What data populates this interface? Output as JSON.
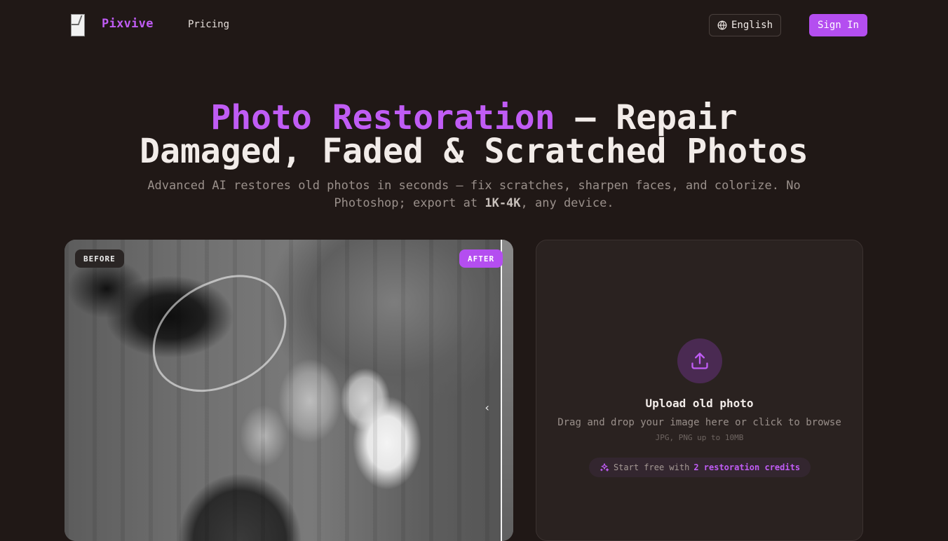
{
  "nav": {
    "brand": "Pixvive",
    "links": [
      "Pricing"
    ],
    "language": "English",
    "sign_in": "Sign In"
  },
  "hero": {
    "title_accent": "Photo Restoration",
    "title_rest": " — Repair",
    "title_line2": "Damaged, Faded & Scratched Photos",
    "subtitle_pre": "Advanced AI restores old photos in seconds — fix scratches, sharpen faces, and colorize. No Photoshop; export at ",
    "subtitle_bold": "1K-4K",
    "subtitle_post": ", any device."
  },
  "compare": {
    "before_label": "BEFORE",
    "after_label": "AFTER",
    "handle_icon": "chevron-left-icon"
  },
  "upload": {
    "icon": "upload-icon",
    "title": "Upload old photo",
    "description": "Drag and drop your image here or click to browse",
    "formats": "JPG, PNG up to 10MB",
    "credits_prefix": "Start free with ",
    "credits_highlight": "2 restoration credits",
    "credits_icon": "sparkles-icon"
  },
  "colors": {
    "background": "#201816",
    "accent": "#b44ef0",
    "accent_text": "#c05cf5"
  }
}
